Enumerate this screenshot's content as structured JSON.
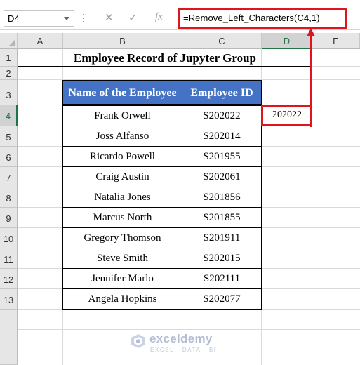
{
  "formula_bar": {
    "name_box": "D4",
    "cancel_icon": "✕",
    "enter_icon": "✓",
    "fx_label": "fx",
    "formula": "=Remove_Left_Characters(C4,1)"
  },
  "columns": [
    "A",
    "B",
    "C",
    "D",
    "E"
  ],
  "rows": [
    "1",
    "2",
    "3",
    "4",
    "5",
    "6",
    "7",
    "8",
    "9",
    "10",
    "11",
    "12",
    "13"
  ],
  "selected_cell": "D4",
  "sheet": {
    "title": "Employee Record of Jupyter Group",
    "headers": {
      "name": "Name of the Employee",
      "id": "Employee ID"
    },
    "records": [
      {
        "name": "Frank Orwell",
        "id": "S202022"
      },
      {
        "name": "Joss Alfanso",
        "id": "S202014"
      },
      {
        "name": "Ricardo Powell",
        "id": "S201955"
      },
      {
        "name": "Craig Austin",
        "id": "S202061"
      },
      {
        "name": "Natalia Jones",
        "id": "S201856"
      },
      {
        "name": "Marcus North",
        "id": "S201855"
      },
      {
        "name": "Gregory Thomson",
        "id": "S201911"
      },
      {
        "name": "Steve Smith",
        "id": "S202015"
      },
      {
        "name": "Jennifer Marlo",
        "id": "S202111"
      },
      {
        "name": "Angela Hopkins",
        "id": "S202077"
      }
    ],
    "result": "202022"
  },
  "watermark": {
    "name": "exceldemy",
    "tagline": "EXCEL · DATA · BI"
  },
  "colors": {
    "header_fill": "#4472c4",
    "highlight": "#e0141f",
    "excel_green": "#217346"
  }
}
